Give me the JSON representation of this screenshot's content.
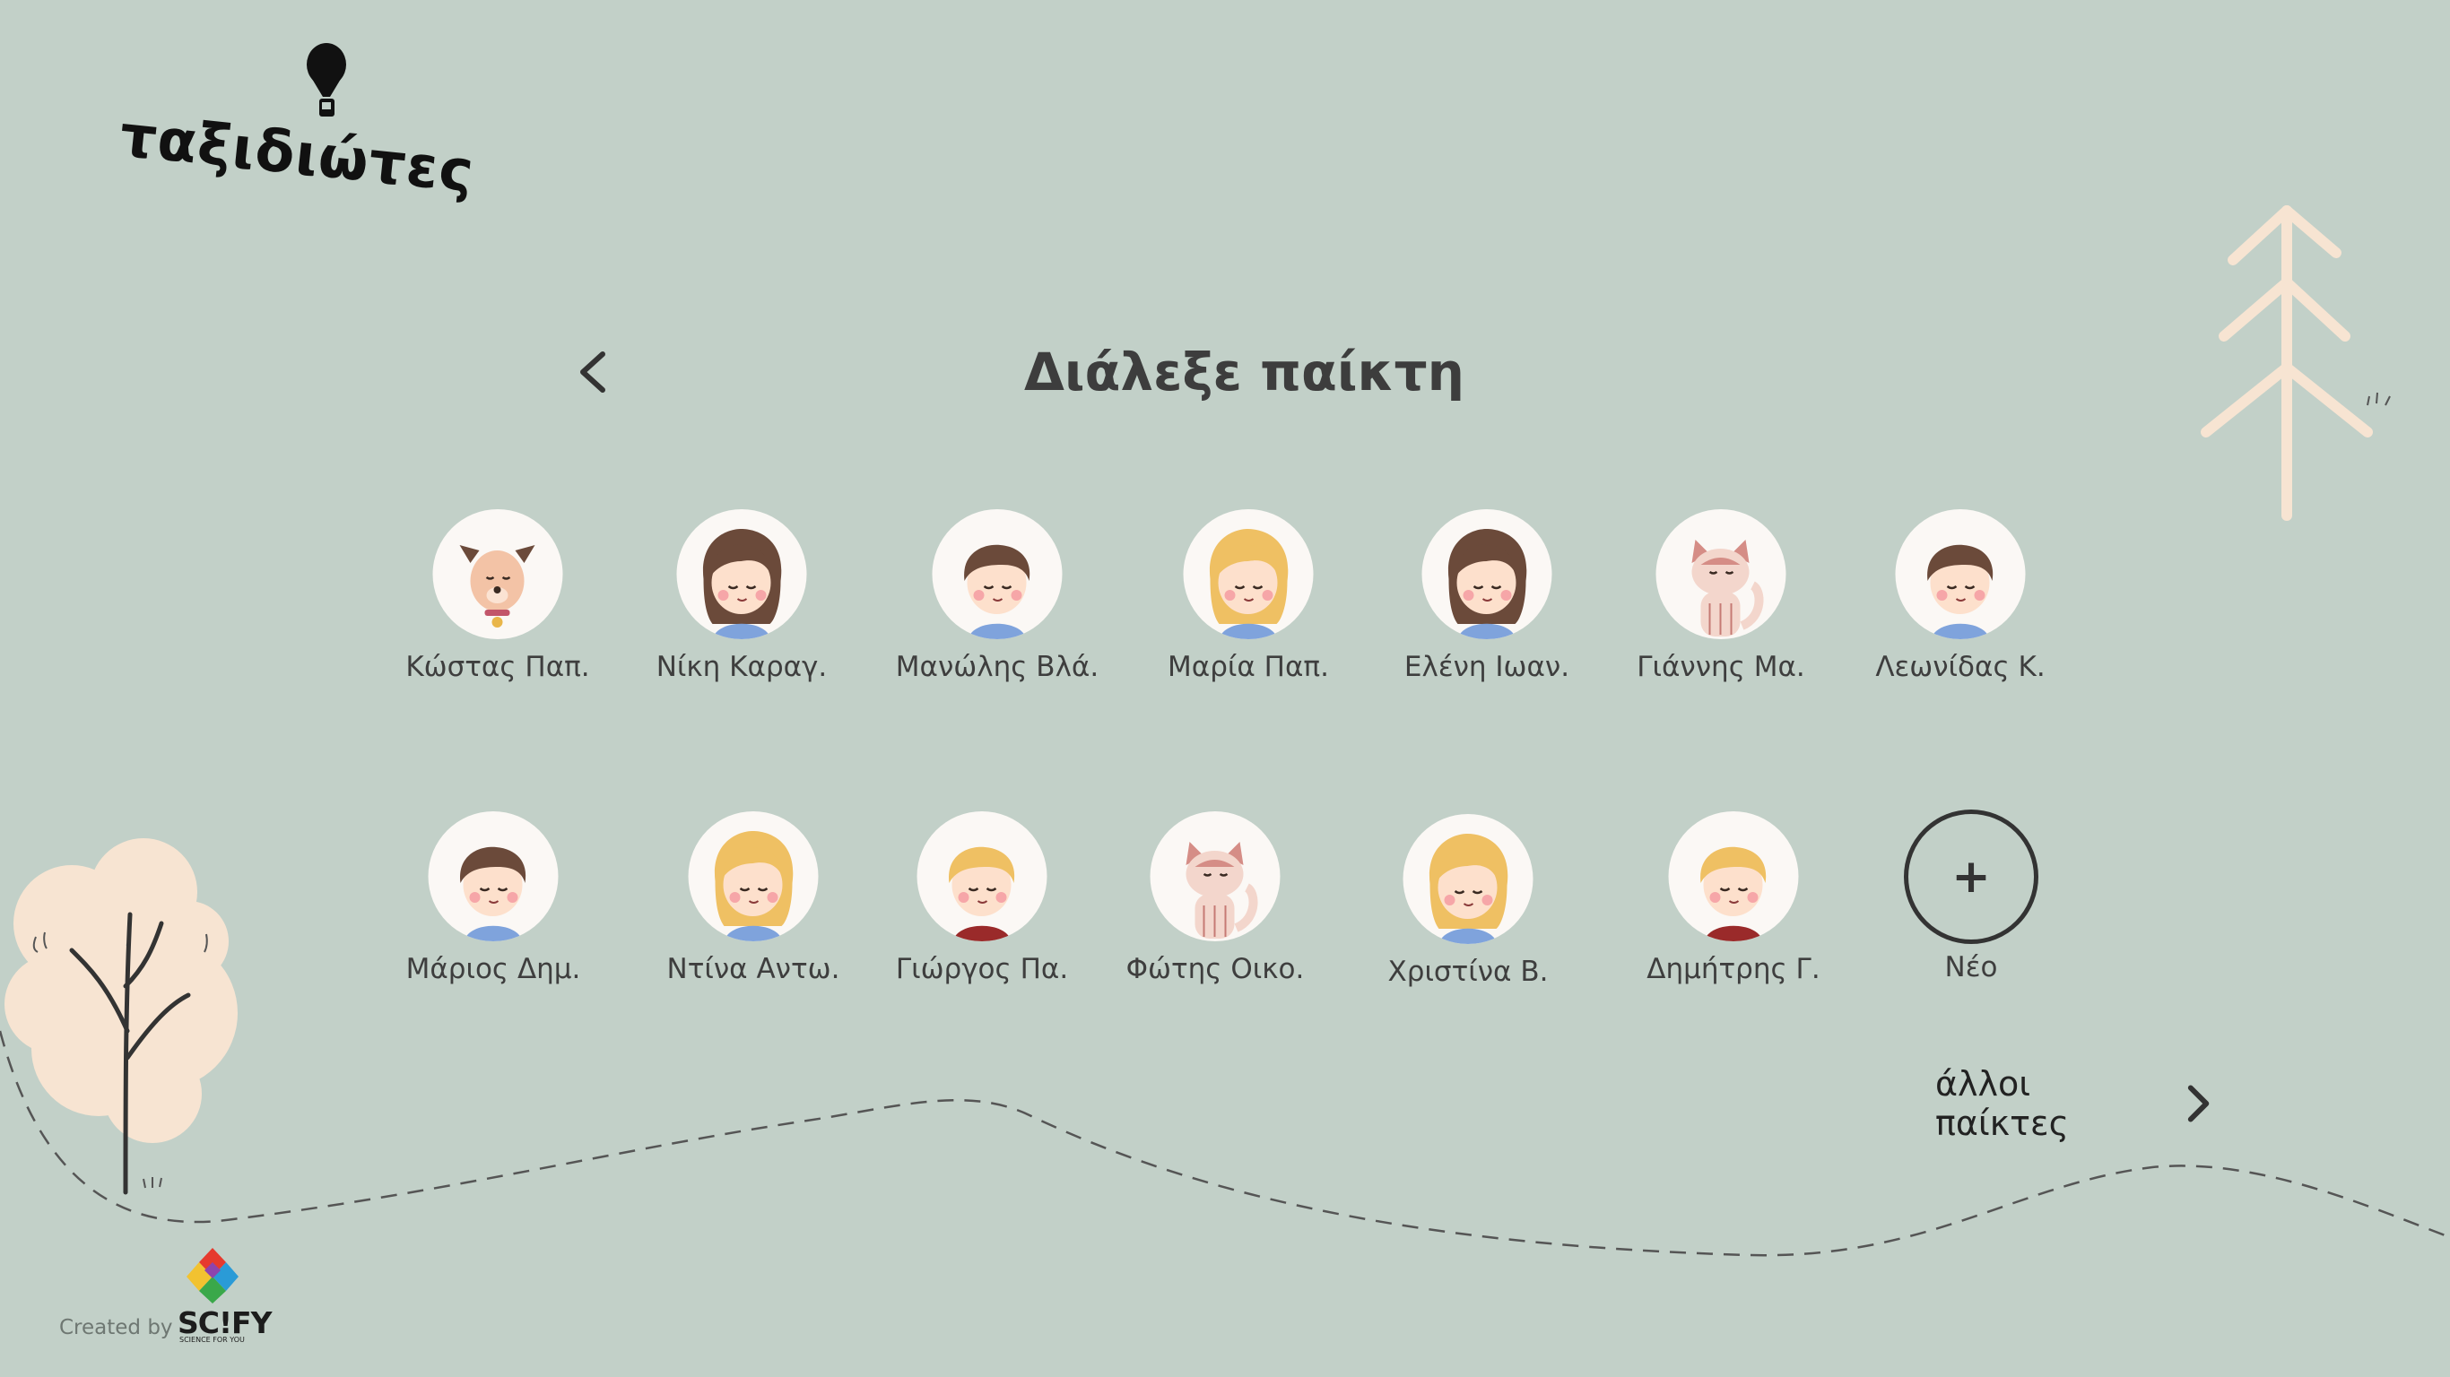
{
  "app": {
    "logo_text": "ταξιδιώτες"
  },
  "header": {
    "title": "Διάλεξε παίκτη",
    "back_icon": "chevron-left-icon"
  },
  "players": [
    {
      "name": "Κώστας Παπ.",
      "avatar": "dog-avatar"
    },
    {
      "name": "Νίκη Καραγ.",
      "avatar": "girl-brown-hair-avatar"
    },
    {
      "name": "Μανώλης Βλά.",
      "avatar": "boy-brown-hair-avatar"
    },
    {
      "name": "Μαρία Παπ.",
      "avatar": "girl-blonde-hair-avatar"
    },
    {
      "name": "Ελένη Ιωαν.",
      "avatar": "girl-brown-hair-avatar"
    },
    {
      "name": "Γιάννης Μα.",
      "avatar": "cat-avatar"
    },
    {
      "name": "Λεωνίδας Κ.",
      "avatar": "boy-brown-hair-avatar"
    },
    {
      "name": "Μάριος Δημ.",
      "avatar": "boy-brown-hair-avatar"
    },
    {
      "name": "Ντίνα Αντω.",
      "avatar": "girl-blonde-hair-avatar"
    },
    {
      "name": "Γιώργος Πα.",
      "avatar": "boy-blonde-hair-avatar"
    },
    {
      "name": "Φώτης Οικο.",
      "avatar": "cat-avatar"
    },
    {
      "name": "Χριστίνα Β.",
      "avatar": "girl-blonde-hair-avatar"
    },
    {
      "name": "Δημήτρης Γ.",
      "avatar": "boy-blonde-hair-avatar"
    }
  ],
  "new_player": {
    "label": "Νέο",
    "icon": "plus-icon"
  },
  "more_players": {
    "label": "άλλοι παίκτες",
    "icon": "chevron-right-icon"
  },
  "footer": {
    "created_by": "Created by",
    "brand": "SC!FY",
    "tagline": "SCIENCE FOR YOU"
  },
  "colors": {
    "background": "#c2d0c8",
    "tree": "#f7e4d2",
    "text": "#3d3d3d"
  }
}
